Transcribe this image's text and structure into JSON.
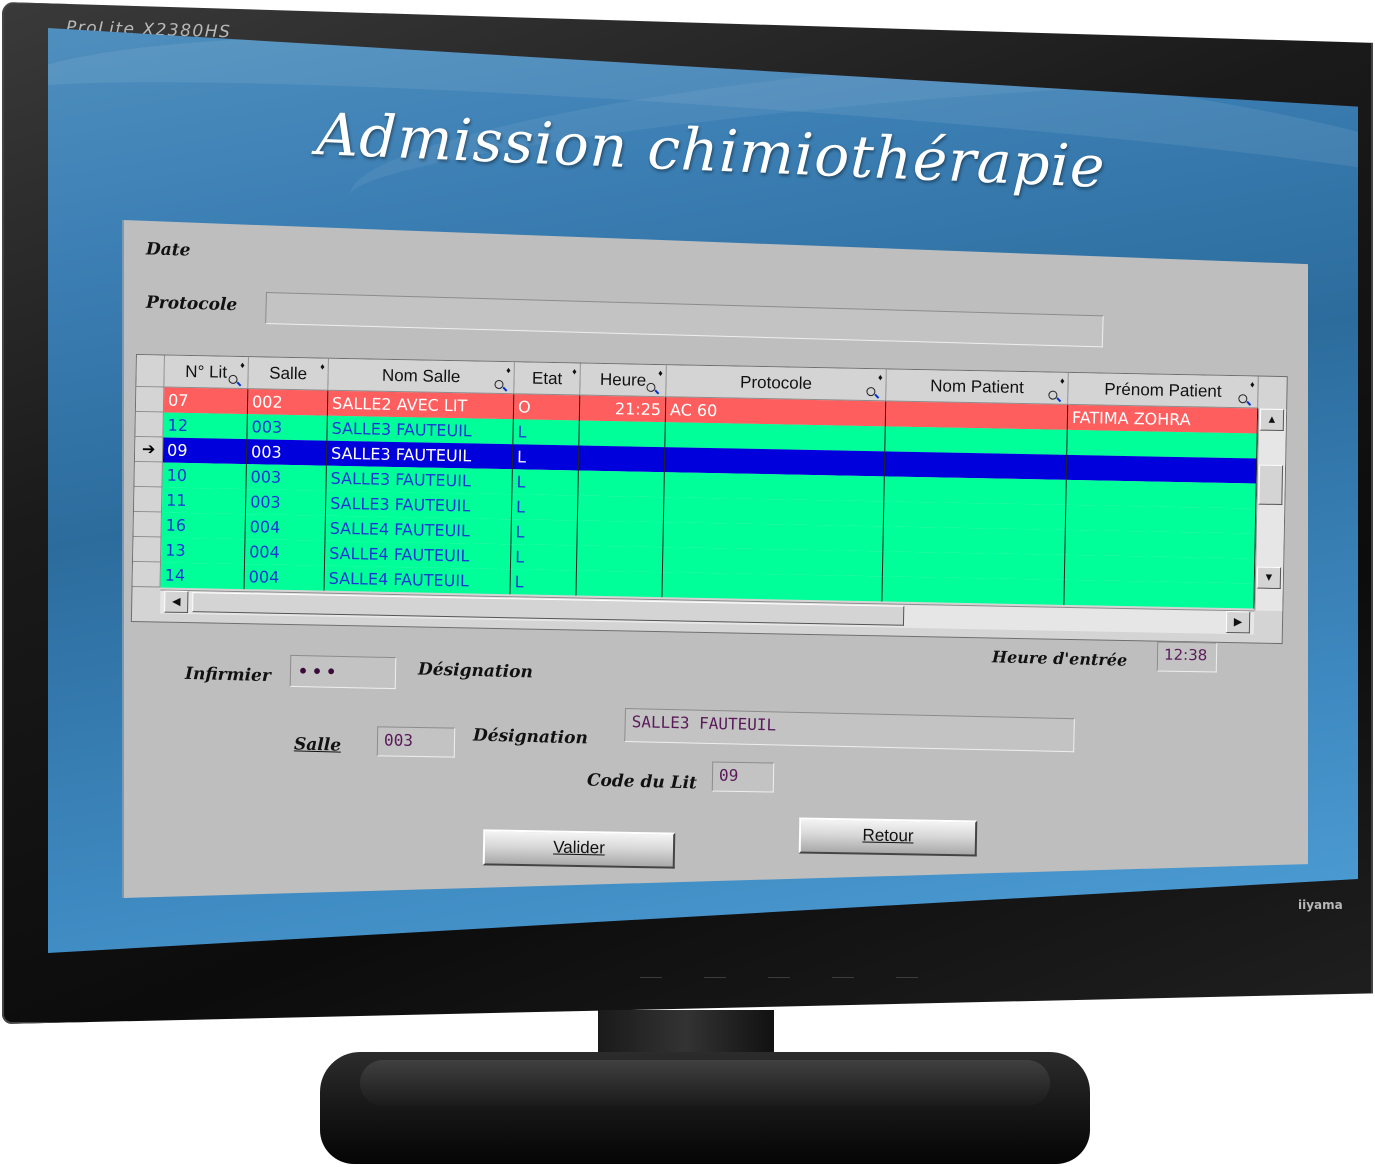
{
  "monitor": {
    "model": "ProLite X2380HS",
    "brand": "iiyama"
  },
  "app": {
    "title": "Admission chimiothérapie"
  },
  "form": {
    "date_label": "Date",
    "protocole_label": "Protocole",
    "protocole_value": "",
    "infirmier_label": "Infirmier",
    "infirmier_value": "•••",
    "designation_label": "Désignation",
    "heure_entree_label": "Heure d'entrée",
    "heure_entree_value": "12:38",
    "salle_label": "Salle",
    "salle_value": "003",
    "salle_designation_label": "Désignation",
    "salle_designation_value": "SALLE3  FAUTEUIL",
    "code_lit_label": "Code du Lit",
    "code_lit_value": "09"
  },
  "buttons": {
    "valider": "Valider",
    "retour": "Retour"
  },
  "grid": {
    "columns": [
      {
        "label": "N° Lit",
        "search": true
      },
      {
        "label": "Salle",
        "search": false
      },
      {
        "label": "Nom Salle",
        "search": true
      },
      {
        "label": "Etat",
        "search": false
      },
      {
        "label": "Heure",
        "search": true
      },
      {
        "label": "Protocole",
        "search": true
      },
      {
        "label": "Nom Patient",
        "search": true
      },
      {
        "label": "Prénom Patient",
        "search": true
      }
    ],
    "rows": [
      {
        "lit": "07",
        "salle": "002",
        "nom_salle": "SALLE2 AVEC LIT",
        "etat": "O",
        "heure": "21:25",
        "protocole": "AC 60",
        "nom_patient": "",
        "prenom_patient": "FATIMA ZOHRA",
        "status": "occupied"
      },
      {
        "lit": "12",
        "salle": "003",
        "nom_salle": "SALLE3  FAUTEUIL",
        "etat": "L",
        "heure": "",
        "protocole": "",
        "nom_patient": "",
        "prenom_patient": "",
        "status": "free"
      },
      {
        "lit": "09",
        "salle": "003",
        "nom_salle": "SALLE3  FAUTEUIL",
        "etat": "L",
        "heure": "",
        "protocole": "",
        "nom_patient": "",
        "prenom_patient": "",
        "status": "selected"
      },
      {
        "lit": "10",
        "salle": "003",
        "nom_salle": "SALLE3  FAUTEUIL",
        "etat": "L",
        "heure": "",
        "protocole": "",
        "nom_patient": "",
        "prenom_patient": "",
        "status": "free"
      },
      {
        "lit": "11",
        "salle": "003",
        "nom_salle": "SALLE3  FAUTEUIL",
        "etat": "L",
        "heure": "",
        "protocole": "",
        "nom_patient": "",
        "prenom_patient": "",
        "status": "free"
      },
      {
        "lit": "16",
        "salle": "004",
        "nom_salle": "SALLE4  FAUTEUIL",
        "etat": "L",
        "heure": "",
        "protocole": "",
        "nom_patient": "",
        "prenom_patient": "",
        "status": "free"
      },
      {
        "lit": "13",
        "salle": "004",
        "nom_salle": "SALLE4  FAUTEUIL",
        "etat": "L",
        "heure": "",
        "protocole": "",
        "nom_patient": "",
        "prenom_patient": "",
        "status": "free"
      },
      {
        "lit": "14",
        "salle": "004",
        "nom_salle": "SALLE4  FAUTEUIL",
        "etat": "L",
        "heure": "",
        "protocole": "",
        "nom_patient": "",
        "prenom_patient": "",
        "status": "free"
      }
    ],
    "row_indicator_icon": "arrow-right-icon"
  },
  "colors": {
    "occupied_bg": "#ff5e5e",
    "occupied_text": "#ffffff",
    "free_bg": "#00ff99",
    "free_text": "#1a33d6",
    "selected_bg": "#0000dd",
    "selected_text": "#ffffff"
  }
}
